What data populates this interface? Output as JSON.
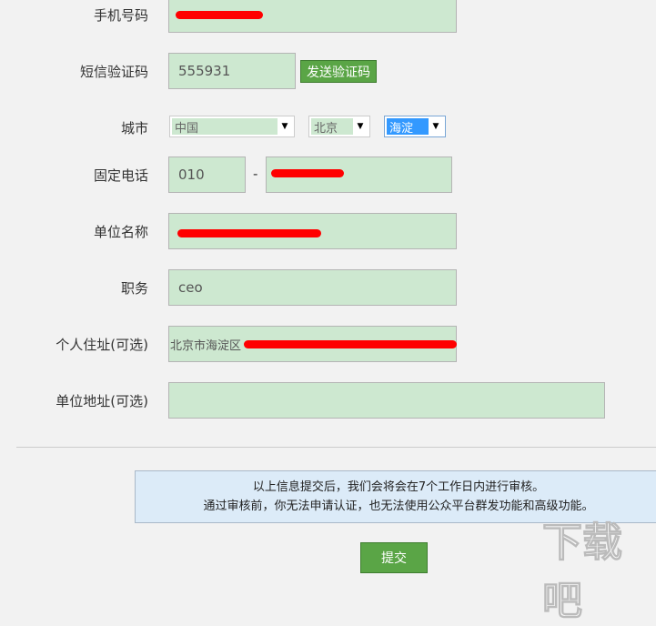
{
  "fields": {
    "mobile": {
      "label": "手机号码",
      "value": ""
    },
    "sms": {
      "label": "短信验证码",
      "value": "555931",
      "button": "发送验证码"
    },
    "city": {
      "label": "城市",
      "country": "中国",
      "province": "北京",
      "district": "海淀"
    },
    "phone": {
      "label": "固定电话",
      "area": "010",
      "sep": "-",
      "number": ""
    },
    "company": {
      "label": "单位名称",
      "value": ""
    },
    "title": {
      "label": "职务",
      "value": "ceo"
    },
    "address": {
      "label": "个人住址(可选)",
      "value": "北京市海淀区"
    },
    "company_address": {
      "label": "单位地址(可选)",
      "value": ""
    }
  },
  "notice": {
    "line1": "以上信息提交后，我们会将会在7个工作日内进行审核。",
    "line2": "通过审核前，你无法申请认证，也无法使用公众平台群发功能和高级功能。"
  },
  "submit": "提交",
  "watermark": "下载吧 www.xiazaiba.com"
}
